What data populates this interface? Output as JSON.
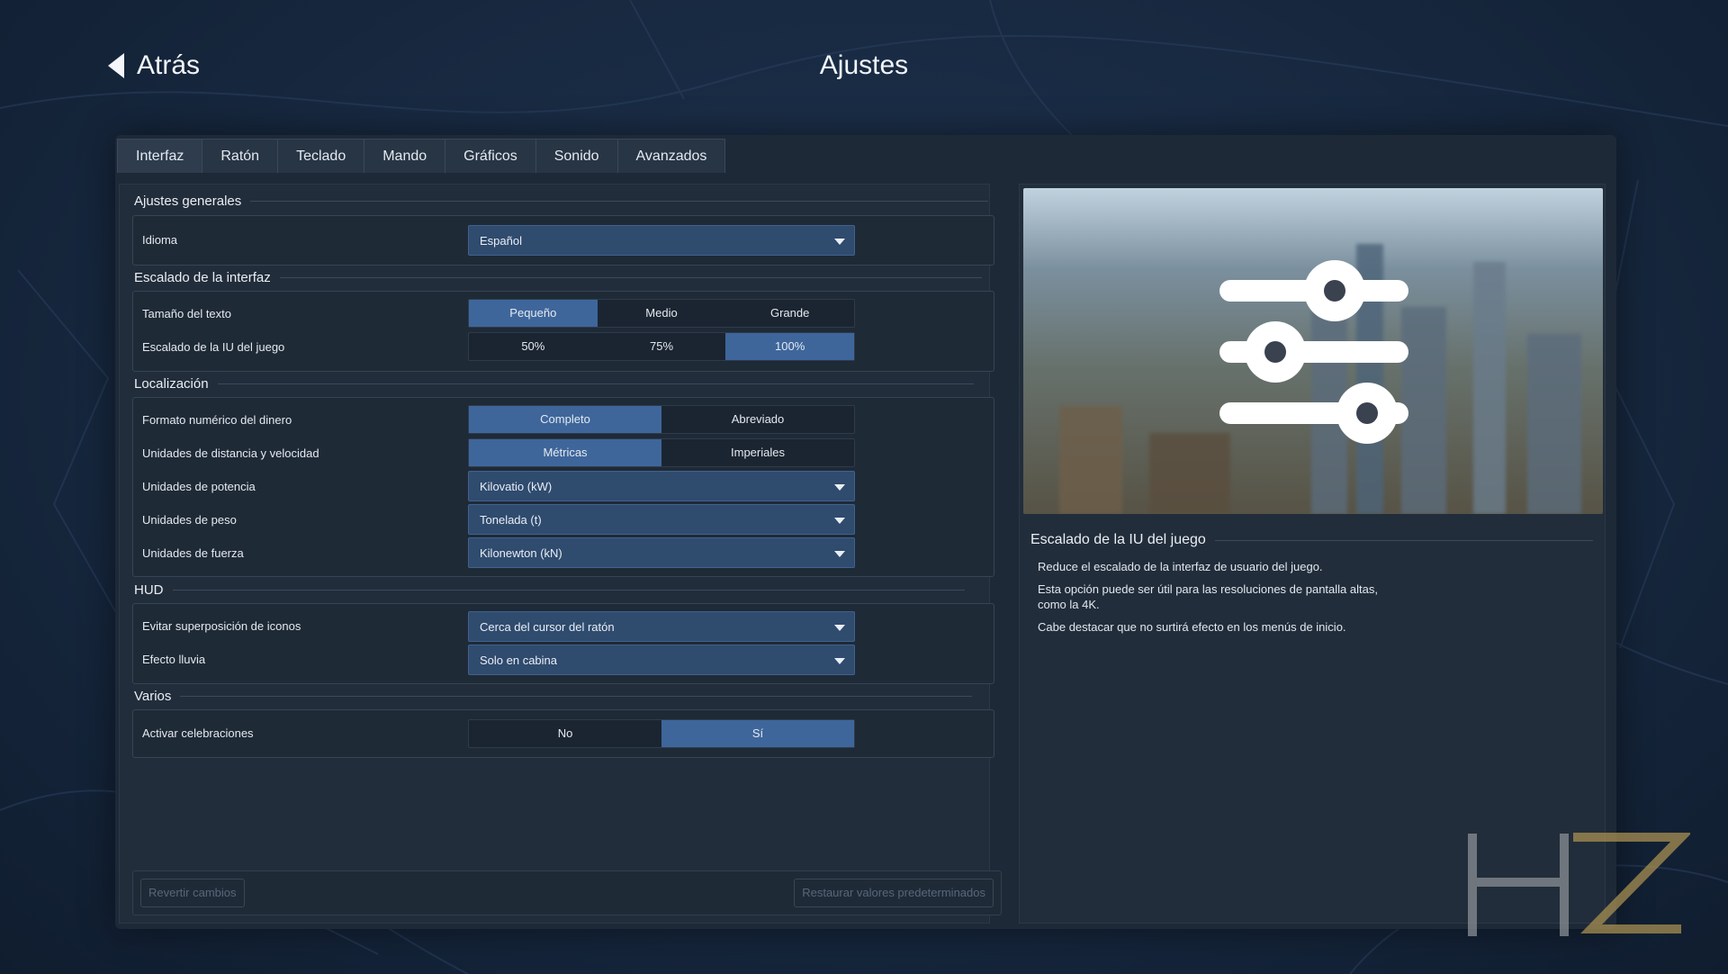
{
  "header": {
    "back_label": "Atrás",
    "title": "Ajustes"
  },
  "tabs": [
    {
      "label": "Interfaz",
      "active": true
    },
    {
      "label": "Ratón"
    },
    {
      "label": "Teclado"
    },
    {
      "label": "Mando"
    },
    {
      "label": "Gráficos"
    },
    {
      "label": "Sonido"
    },
    {
      "label": "Avanzados"
    }
  ],
  "sections": {
    "general": {
      "title": "Ajustes generales",
      "language_label": "Idioma",
      "language_value": "Español"
    },
    "scaling": {
      "title": "Escalado de la interfaz",
      "text_size_label": "Tamaño del texto",
      "text_size_options": [
        "Pequeño",
        "Medio",
        "Grande"
      ],
      "text_size_selected": "Pequeño",
      "ui_scale_label": "Escalado de la IU del juego",
      "ui_scale_options": [
        "50%",
        "75%",
        "100%"
      ],
      "ui_scale_selected": "100%"
    },
    "localization": {
      "title": "Localización",
      "money_label": "Formato numérico del dinero",
      "money_options": [
        "Completo",
        "Abreviado"
      ],
      "money_selected": "Completo",
      "distance_label": "Unidades de distancia y velocidad",
      "distance_options": [
        "Métricas",
        "Imperiales"
      ],
      "distance_selected": "Métricas",
      "power_label": "Unidades de potencia",
      "power_value": "Kilovatio (kW)",
      "weight_label": "Unidades de peso",
      "weight_value": "Tonelada (t)",
      "force_label": "Unidades de fuerza",
      "force_value": "Kilonewton (kN)"
    },
    "hud": {
      "title": "HUD",
      "overlap_label": "Evitar superposición de iconos",
      "overlap_value": "Cerca del cursor del ratón",
      "rain_label": "Efecto lluvia",
      "rain_value": "Solo en cabina"
    },
    "misc": {
      "title": "Varios",
      "celebrations_label": "Activar celebraciones",
      "celebrations_options": [
        "No",
        "Sí"
      ],
      "celebrations_selected": "Sí"
    }
  },
  "footer": {
    "revert_label": "Revertir cambios",
    "restore_label": "Restaurar valores predeterminados"
  },
  "description": {
    "title": "Escalado de la IU del juego",
    "paragraphs": [
      "Reduce el escalado de la interfaz de usuario del juego.",
      "Esta opción puede ser útil para las resoluciones de pantalla altas, como la 4K.",
      "Cabe destacar que no surtirá efecto en los menús de inicio."
    ]
  },
  "colors": {
    "accent": "#3e669b",
    "dropdown": "#2f4b6e",
    "panel": "#222d3b",
    "logo_gray": "#8a8f96",
    "logo_gold": "#a88f52"
  },
  "icons": {
    "back": "back-arrow-icon",
    "preview": "sliders-icon",
    "dropdown": "chevron-down-icon"
  }
}
